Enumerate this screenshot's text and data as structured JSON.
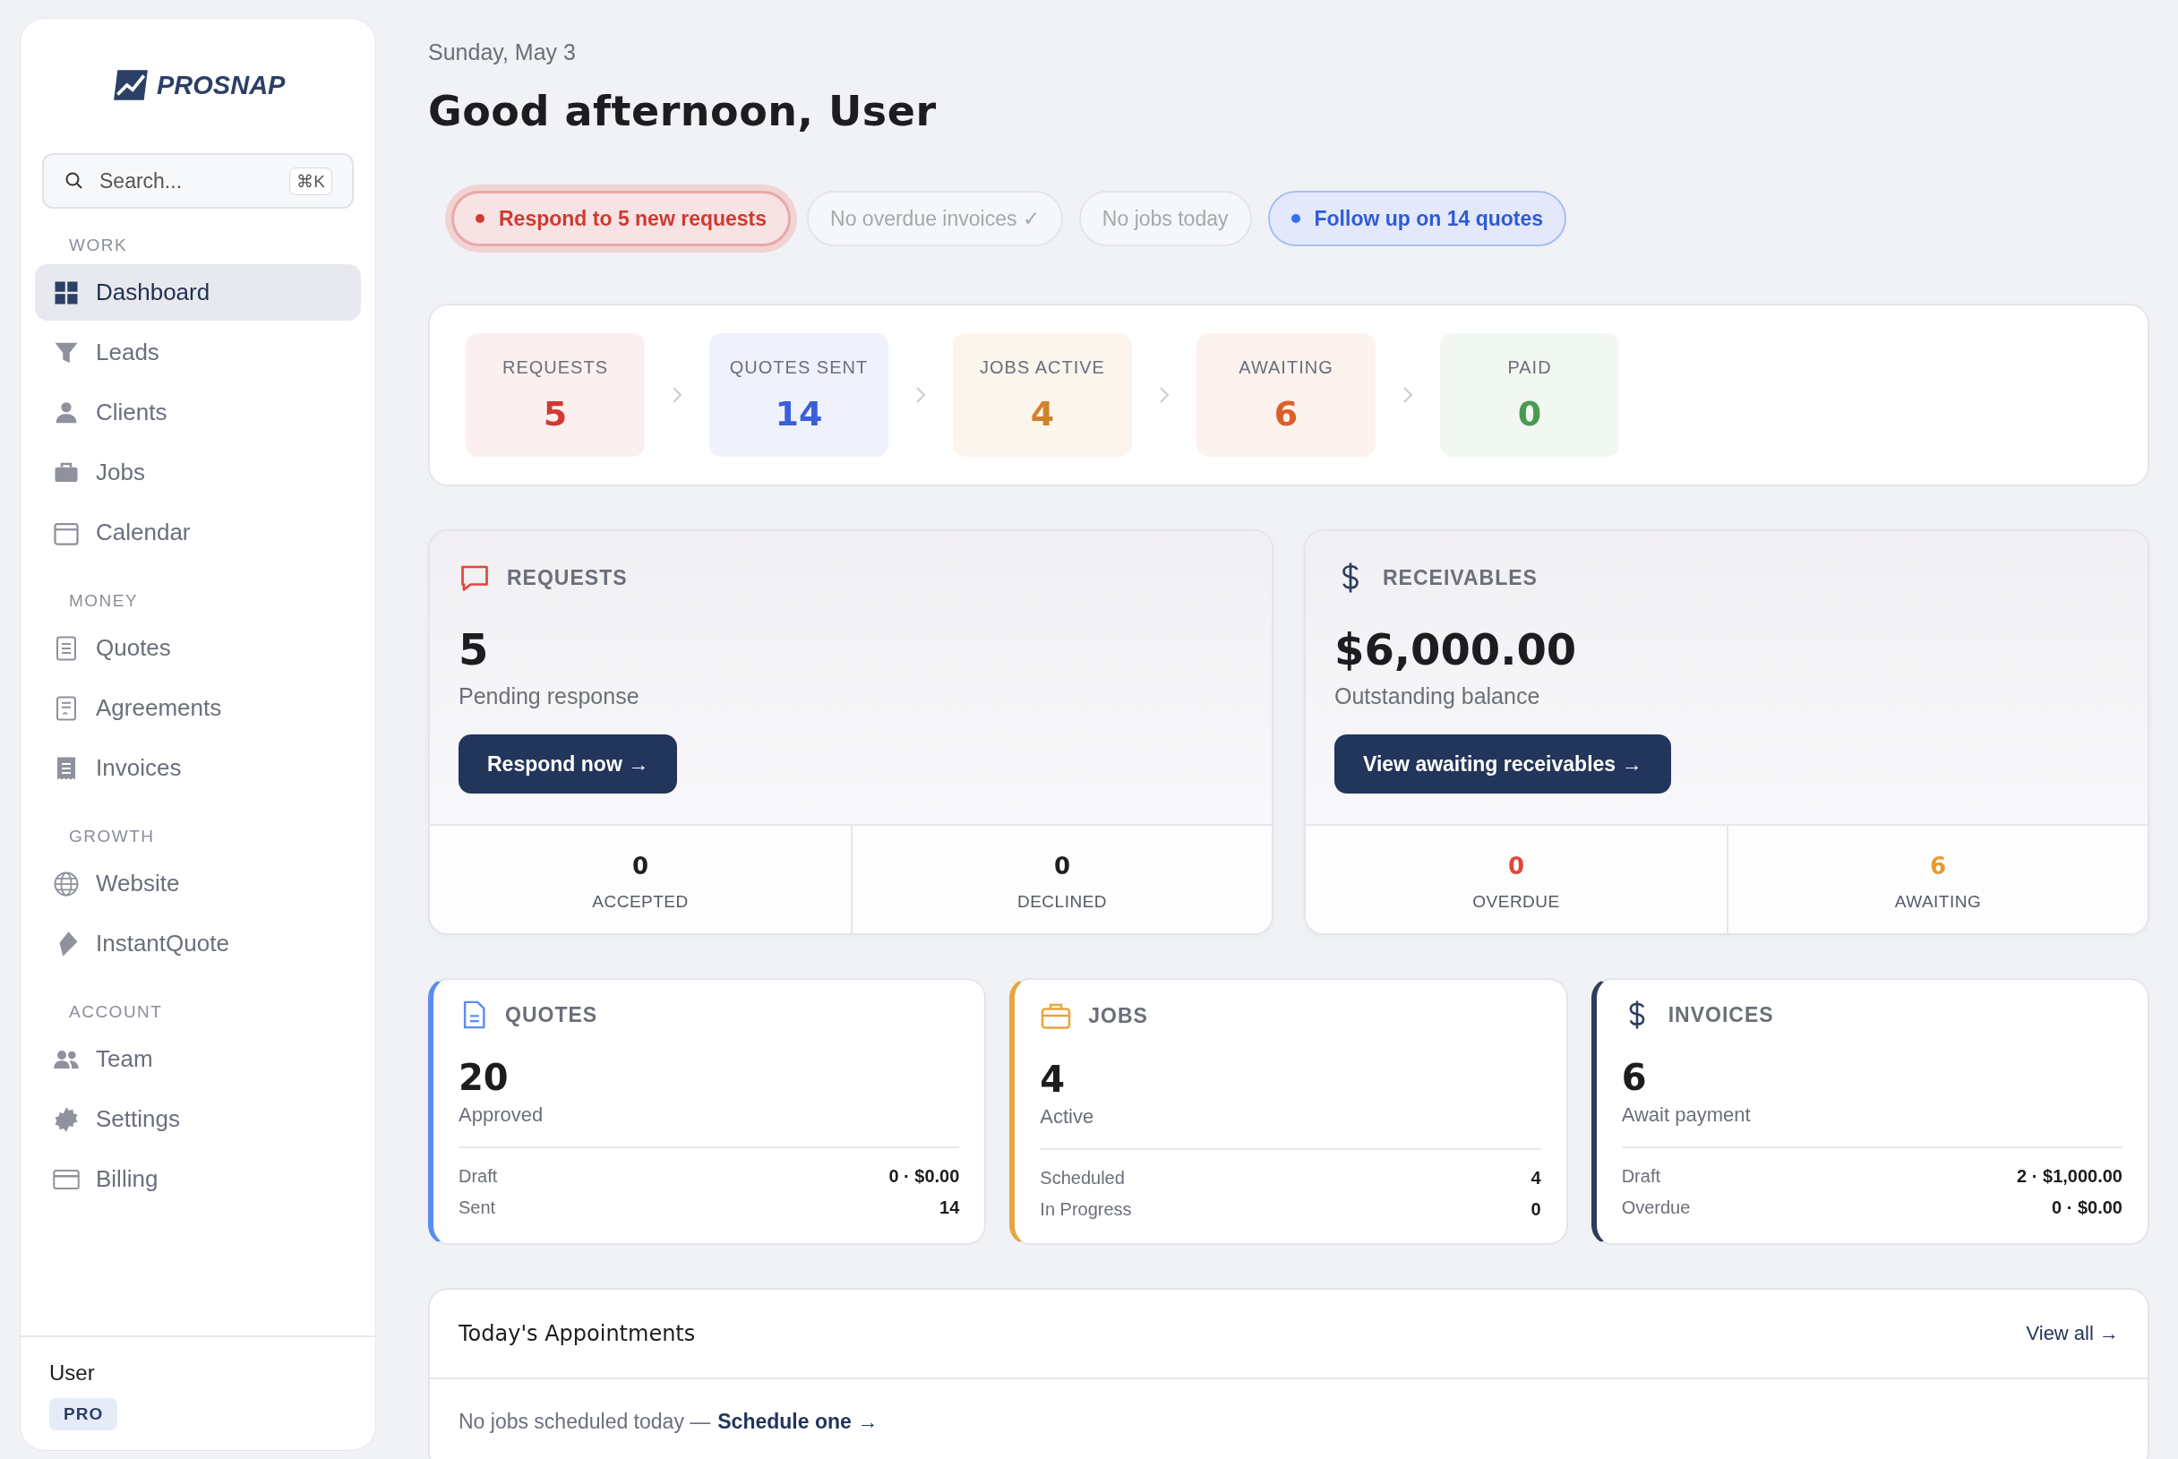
{
  "sidebar": {
    "logo": "PROSNAP",
    "search": {
      "placeholder": "Search...",
      "shortcut": "⌘K"
    },
    "sections": [
      {
        "title": "WORK",
        "items": [
          {
            "label": "Dashboard",
            "selected": true
          },
          {
            "label": "Leads",
            "selected": false
          },
          {
            "label": "Clients",
            "selected": false
          },
          {
            "label": "Jobs",
            "selected": false
          },
          {
            "label": "Calendar",
            "selected": false
          }
        ]
      },
      {
        "title": "MONEY",
        "items": [
          {
            "label": "Quotes",
            "selected": false
          },
          {
            "label": "Agreements",
            "selected": false
          },
          {
            "label": "Invoices",
            "selected": false
          }
        ]
      },
      {
        "title": "GROWTH",
        "items": [
          {
            "label": "Website",
            "selected": false
          },
          {
            "label": "InstantQuote",
            "selected": false
          }
        ]
      },
      {
        "title": "ACCOUNT",
        "items": [
          {
            "label": "Team",
            "selected": false
          },
          {
            "label": "Settings",
            "selected": false
          },
          {
            "label": "Billing",
            "selected": false
          }
        ]
      }
    ],
    "user": {
      "name": "User",
      "plan": "PRO"
    }
  },
  "header": {
    "date": "Sunday, May 3",
    "greeting": "Good afternoon, User"
  },
  "chips": [
    {
      "kind": "alert",
      "label": "Respond to 5 new requests"
    },
    {
      "kind": "muted",
      "label": "No overdue invoices ✓"
    },
    {
      "kind": "muted",
      "label": "No jobs today"
    },
    {
      "kind": "info",
      "label": "Follow up on 14 quotes"
    }
  ],
  "pipeline": [
    {
      "label": "REQUESTS",
      "value": "5",
      "color": "#d13a32"
    },
    {
      "label": "QUOTES SENT",
      "value": "14",
      "color": "#3a5fd9"
    },
    {
      "label": "JOBS ACTIVE",
      "value": "4",
      "color": "#d0822a"
    },
    {
      "label": "AWAITING",
      "value": "6",
      "color": "#dc5f28"
    },
    {
      "label": "PAID",
      "value": "0",
      "color": "#4a9a52"
    }
  ],
  "summary_cards": [
    {
      "kind": "requests",
      "title": "REQUESTS",
      "value": "5",
      "subtitle": "Pending response",
      "button": "Respond now →",
      "stats": [
        {
          "value": "0",
          "label": "ACCEPTED",
          "color": "#1f1f23"
        },
        {
          "value": "0",
          "label": "DECLINED",
          "color": "#1f1f23"
        }
      ]
    },
    {
      "kind": "receivables",
      "title": "RECEIVABLES",
      "value": "$6,000.00",
      "subtitle": "Outstanding balance",
      "button": "View awaiting receivables →",
      "stats": [
        {
          "value": "0",
          "label": "OVERDUE",
          "color": "#e0463c"
        },
        {
          "value": "6",
          "label": "AWAITING",
          "color": "#e89a30"
        }
      ]
    }
  ],
  "detail_cards": [
    {
      "kind": "quotes",
      "title": "QUOTES",
      "value": "20",
      "subtitle": "Approved",
      "color": "#5b8df0",
      "rows": [
        {
          "label": "Draft",
          "value": "0 · $0.00"
        },
        {
          "label": "Sent",
          "value": "14"
        }
      ]
    },
    {
      "kind": "jobs",
      "title": "JOBS",
      "value": "4",
      "subtitle": "Active",
      "color": "#e8a540",
      "rows": [
        {
          "label": "Scheduled",
          "value": "4"
        },
        {
          "label": "In Progress",
          "value": "0"
        }
      ]
    },
    {
      "kind": "invoices",
      "title": "INVOICES",
      "value": "6",
      "subtitle": "Await payment",
      "color": "#2d3d5c",
      "rows": [
        {
          "label": "Draft",
          "value": "2 · $1,000.00"
        },
        {
          "label": "Overdue",
          "value": "0 · $0.00"
        }
      ]
    }
  ],
  "appointments": {
    "title": "Today's Appointments",
    "view_all": "View all →",
    "empty_text": "No jobs scheduled today —",
    "empty_link": "Schedule one →"
  }
}
